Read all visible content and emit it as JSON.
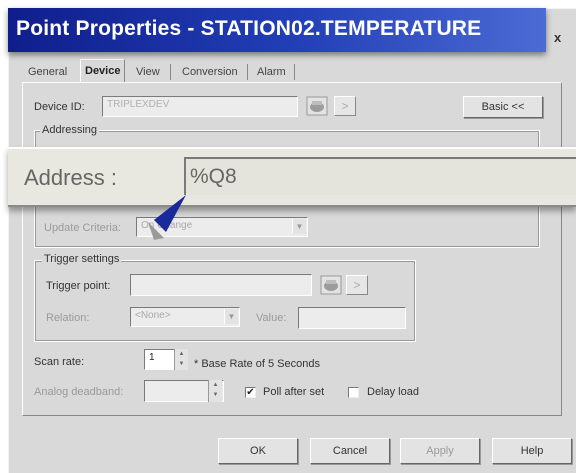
{
  "window": {
    "title": "Point Properties - STATION02.TEMPERATURE",
    "close": "x"
  },
  "tabs": [
    "General",
    "Device",
    "View",
    "Conversion",
    "Alarm"
  ],
  "device": {
    "label": "Device ID:",
    "value": "TRIPLEXDEV",
    "basic_button": "Basic <<",
    "addressing_group": "Addressing"
  },
  "callout": {
    "label": "Address :",
    "value": "%Q8"
  },
  "update": {
    "label": "Update Criteria:",
    "value": "On Change"
  },
  "trigger": {
    "group": "Trigger settings",
    "point_label": "Trigger point:",
    "relation_label": "Relation:",
    "relation_value": "<None>",
    "value_label": "Value:"
  },
  "scan": {
    "label": "Scan rate:",
    "value": "1",
    "note": "* Base Rate of 5 Seconds"
  },
  "deadband": {
    "label": "Analog deadband:"
  },
  "options": {
    "poll_after_set": "Poll after set",
    "poll_checked": "✔",
    "delay_load": "Delay load"
  },
  "footer": {
    "ok": "OK",
    "cancel": "Cancel",
    "apply": "Apply",
    "help": "Help"
  }
}
